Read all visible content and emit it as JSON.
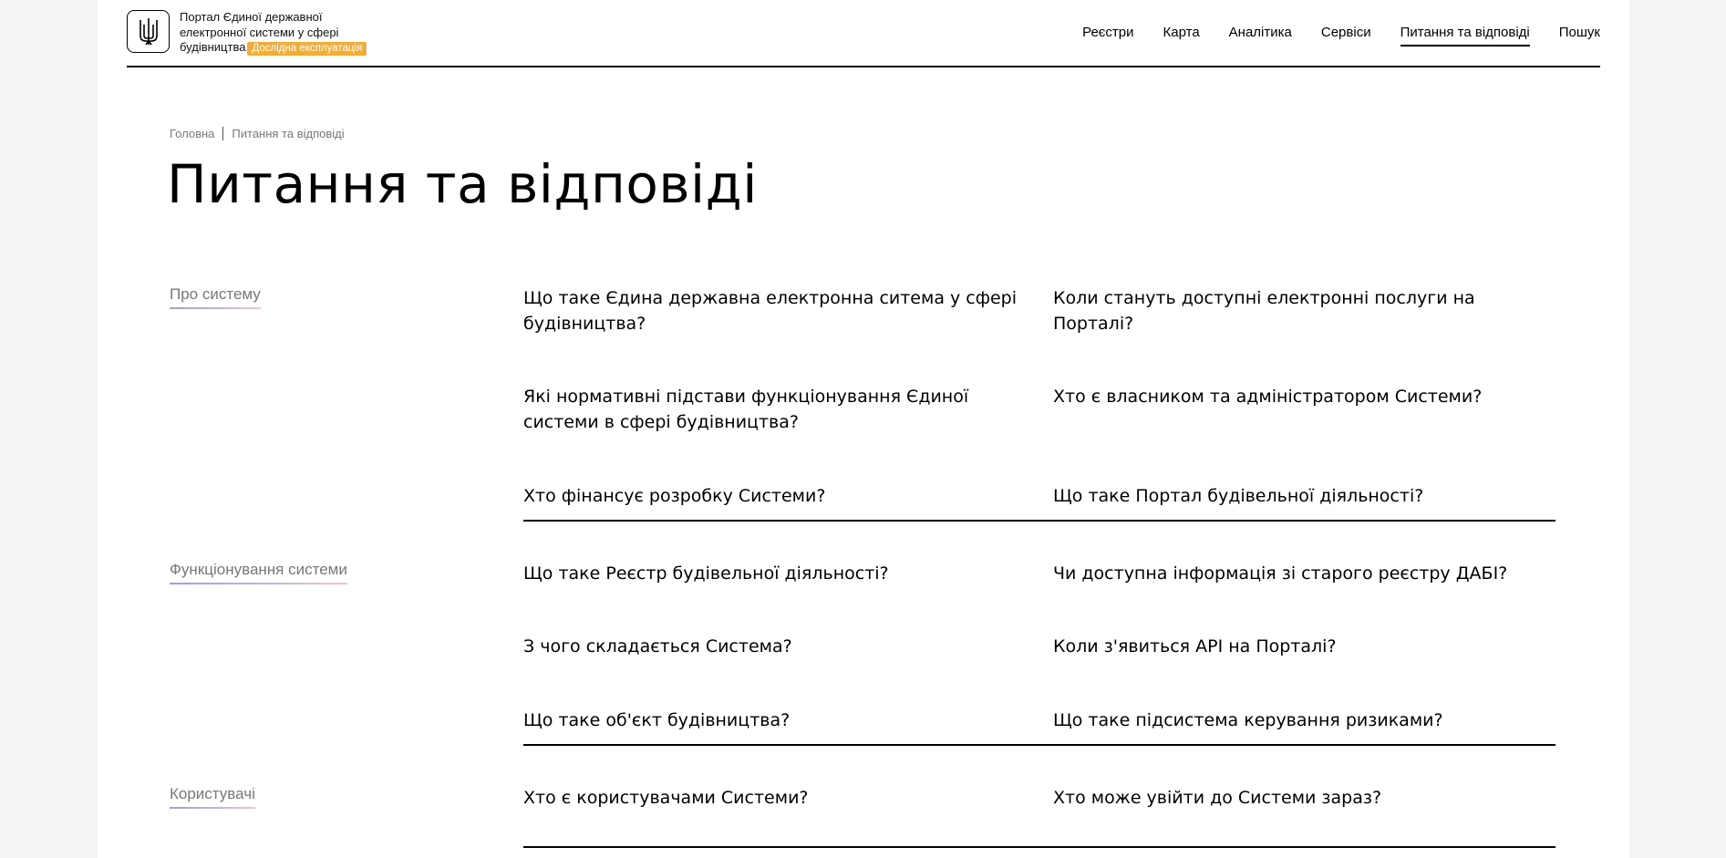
{
  "header": {
    "logo_lines": [
      "Портал Єдиної державної",
      "електронної системи у сфері",
      "будівництва"
    ],
    "badge": "Дослідна експлуатація",
    "nav": [
      "Реєстри",
      "Карта",
      "Аналітика",
      "Сервіси",
      "Питання та відповіді",
      "Пошук"
    ],
    "active_nav_index": 4
  },
  "breadcrumb": {
    "home": "Головна",
    "current": "Питання та відповіді"
  },
  "page_title": "Питання та відповіді",
  "sections": [
    {
      "category": "Про систему",
      "questions": [
        "Що таке Єдина державна електронна ситема у сфері будівництва?",
        "Коли стануть доступні електронні послуги на Порталі?",
        "Які нормативні підстави функціонування Єдиної системи в сфері будівництва?",
        "Хто є власником та адміністратором Системи?",
        "Хто фінансує розробку Системи?",
        "Що таке Портал будівельної діяльності?"
      ]
    },
    {
      "category": "Функціонування системи",
      "questions": [
        "Що таке Реєстр будівельної діяльності?",
        "Чи доступна інформація зі старого реєстру ДАБІ?",
        "З чого складається Система?",
        "Коли з'явиться API на Порталі?",
        "Що таке об'єкт будівництва?",
        "Що таке підсистема керування ризиками?"
      ]
    },
    {
      "category": "Користувачі",
      "questions": [
        "Хто є користувачами Системи?",
        "Хто може увійти до Системи зараз?"
      ]
    }
  ],
  "colors": {
    "badge": "#f0ad3c",
    "category_underline": [
      "#9aa3d6",
      "#f1c8cf"
    ]
  }
}
